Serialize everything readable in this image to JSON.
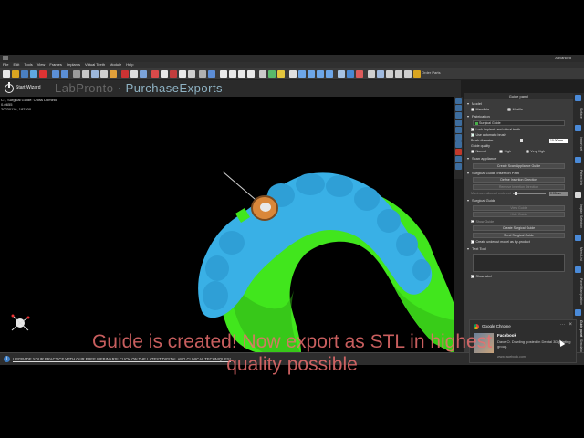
{
  "app": {
    "name": "Advanced"
  },
  "menu": [
    "File",
    "Edit",
    "Tools",
    "View",
    "Frames",
    "Implants",
    "Virtual Teeth",
    "Module",
    "Help"
  ],
  "toolbar": {
    "order_parts_label": "Order Parts"
  },
  "wizard": {
    "start_label": "Start Wizard",
    "logo_part1": "LabPronto",
    "logo_sep": " · ",
    "logo_part2": "PurchaseExports"
  },
  "viewport": {
    "case_lines": [
      "CT, Surgical Guide: Cross Dominic",
      "0-0655",
      "20230116, 182300"
    ],
    "colors": {
      "teeth": "#39b0e6",
      "gums": "#41e61d",
      "sleeve": "#d9873a",
      "bg": "#000000"
    }
  },
  "panel": {
    "title": "Guide panel",
    "sections": {
      "model": {
        "header": "Model",
        "mandible": "Mandible",
        "maxilla": "Maxilla"
      },
      "fabrication": {
        "header": "Fabrication",
        "select_value": "Surgical Guide",
        "lock_implants": "Lock implants and virtual teeth",
        "use_auto_brush": "Use automatic brush",
        "brush_label": "Brush diameter",
        "brush_value": "10.00mm",
        "quality_label": "Guide quality",
        "normal": "Normal",
        "high": "High",
        "very_high": "Very High"
      },
      "scan_appliance": {
        "header": "Scan appliance",
        "button": "Create Scan Appliance Guide"
      },
      "insertion": {
        "header": "Surgical Guide Insertion Path",
        "button1": "Define Insertion Direction",
        "button2": "Remove Insertion Direction",
        "undercut_label": "Maximum allowed undercut",
        "undercut_value": "0.00mm"
      },
      "surgical_guide": {
        "header": "Surgical Guide",
        "btn_view_guide": "View Guide",
        "btn_hide_guide": "Hide Guide",
        "show_guide": "Show Guide",
        "btn_create": "Create Surgical Guide",
        "btn_send": "Send Surgical Guide",
        "undercut_model": "Create undercut model as by-product"
      },
      "text_tool": {
        "header": "Text Tool",
        "show_label": "Show label"
      }
    }
  },
  "vtabs": [
    "Surface",
    "Import set",
    "Patient Info",
    "Implant Selection",
    "Menu List",
    "Panel Manipulation",
    "Guide panel",
    "Simulation"
  ],
  "status": {
    "upgrade_text": "UPGRADE YOUR PRACTICE WITH OUR FREE WEBINARS! CLICK ON THE LATEST DIGITAL AND CLINICAL TECHNIQUES!"
  },
  "notification": {
    "app": "Google Chrome",
    "title": "Facebook",
    "body": "Dave O. Dowling posted in Dental 3D printing group.",
    "site": "www.facebook.com"
  },
  "caption": {
    "line1": "Guide is created! Now export as STL in highest",
    "line2": "quality possible"
  }
}
